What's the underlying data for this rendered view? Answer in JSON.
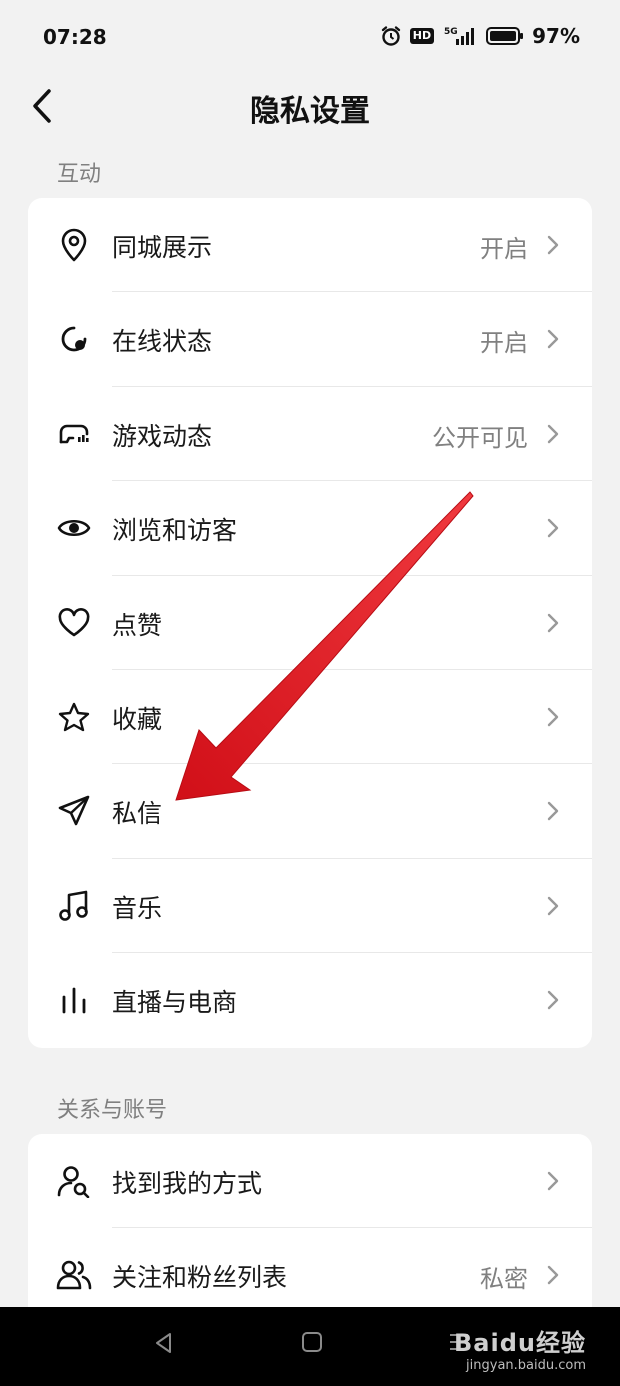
{
  "status_bar": {
    "time": "07:28",
    "hd": "HD",
    "network": "5G",
    "battery": "97%"
  },
  "header": {
    "title": "隐私设置",
    "back_icon": "chevron-left-icon"
  },
  "sections": [
    {
      "label": "互动",
      "items": [
        {
          "icon": "location-pin-icon",
          "label": "同城展示",
          "value": "开启"
        },
        {
          "icon": "online-status-icon",
          "label": "在线状态",
          "value": "开启"
        },
        {
          "icon": "game-controller-icon",
          "label": "游戏动态",
          "value": "公开可见"
        },
        {
          "icon": "eye-icon",
          "label": "浏览和访客",
          "value": ""
        },
        {
          "icon": "heart-icon",
          "label": "点赞",
          "value": ""
        },
        {
          "icon": "star-icon",
          "label": "收藏",
          "value": ""
        },
        {
          "icon": "paper-plane-icon",
          "label": "私信",
          "value": ""
        },
        {
          "icon": "music-note-icon",
          "label": "音乐",
          "value": ""
        },
        {
          "icon": "bar-chart-icon",
          "label": "直播与电商",
          "value": ""
        }
      ]
    },
    {
      "label": "关系与账号",
      "items": [
        {
          "icon": "user-search-icon",
          "label": "找到我的方式",
          "value": ""
        },
        {
          "icon": "users-icon",
          "label": "关注和粉丝列表",
          "value": "私密"
        }
      ]
    }
  ],
  "colors": {
    "background": "#f2f2f2",
    "card": "#ffffff",
    "arrow": "#e0161e",
    "secondary_text": "#808080"
  },
  "watermark": {
    "logo": "Baidu经验",
    "url": "jingyan.baidu.com"
  }
}
